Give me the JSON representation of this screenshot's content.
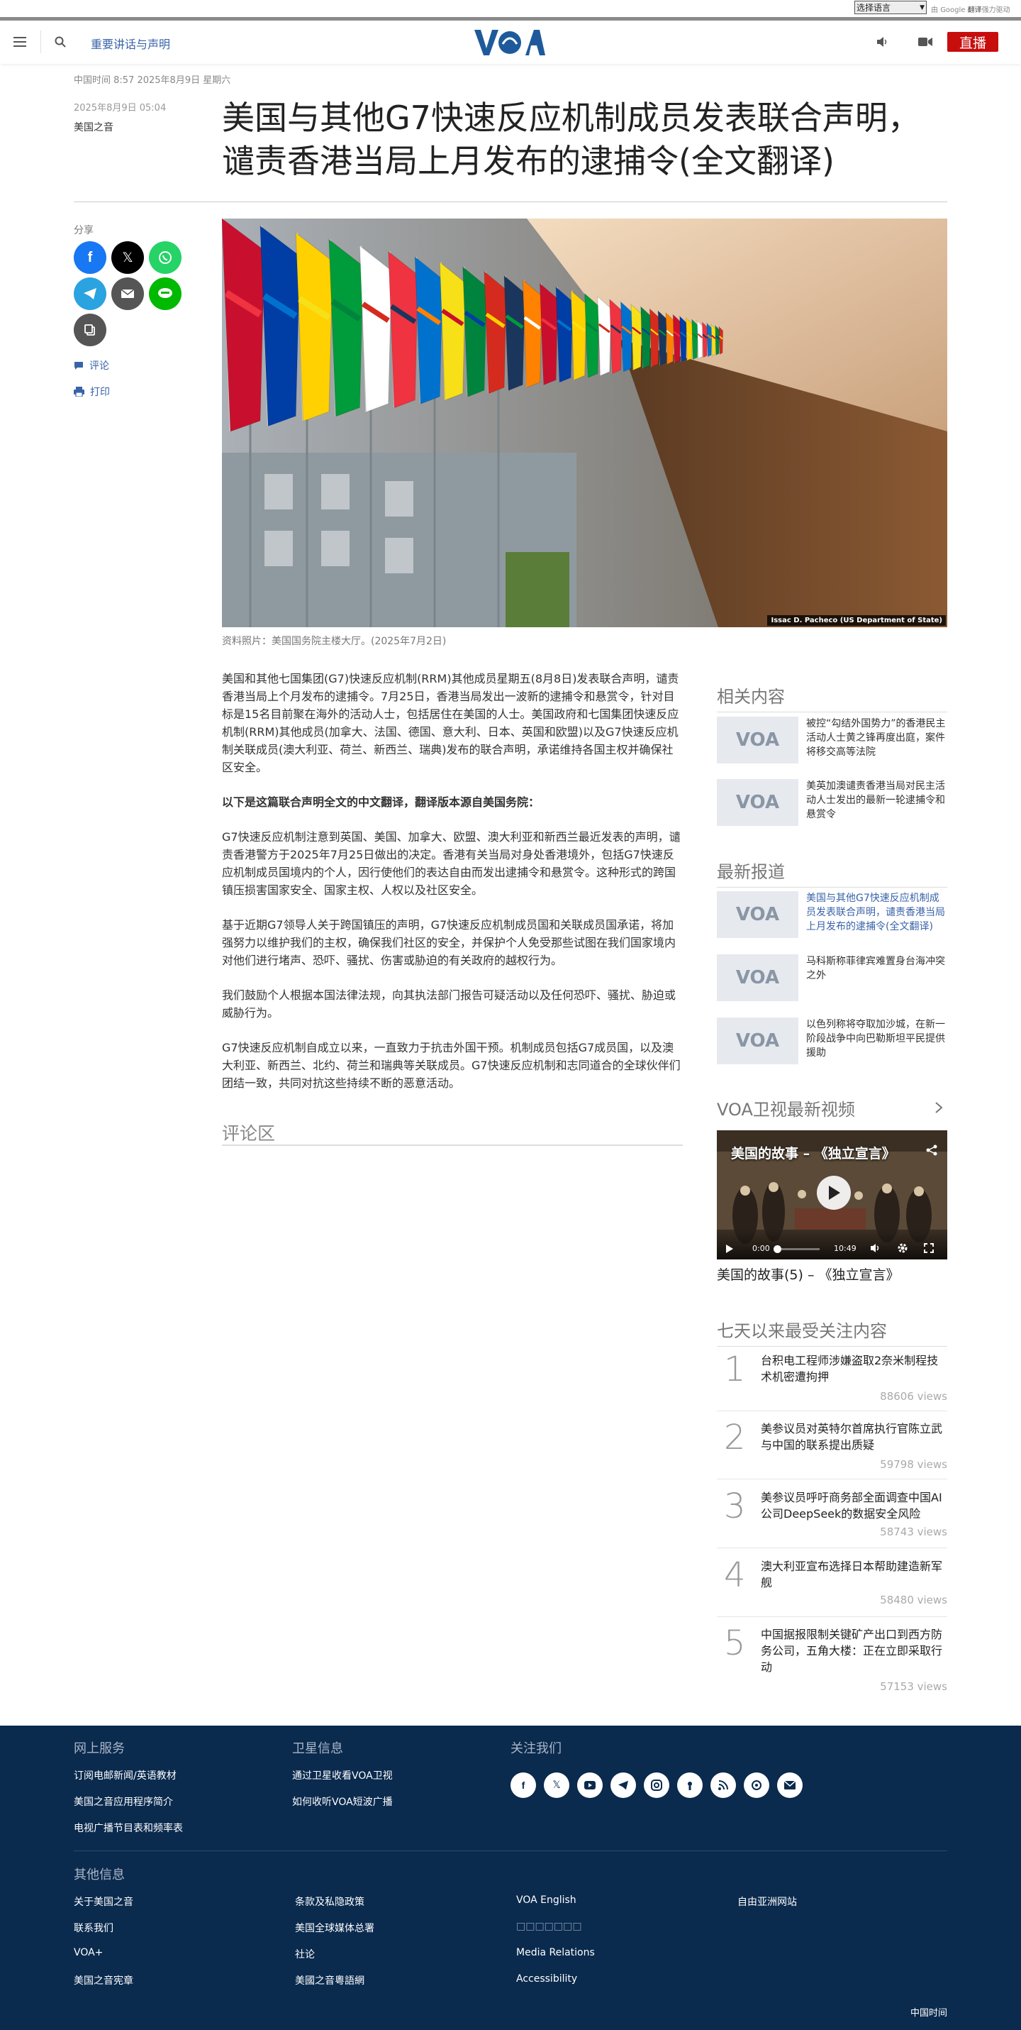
{
  "translate": {
    "select_label": "选择语言",
    "credit_by": "由",
    "credit_google": "Google",
    "credit_translate": "翻译",
    "credit_tail": "强力驱动"
  },
  "header": {
    "section_link": "重要讲话与声明",
    "logo": "VOA",
    "live_label": "直播"
  },
  "dateline": "中国时间 8:57 2025年8月9日 星期六",
  "article": {
    "title": "美国与其他G7快速反应机制成员发表联合声明，谴责香港当局上月发布的逮捕令(全文翻译)",
    "date": "2025年8月9日 05:04",
    "author": "美国之音",
    "image_credit": "Issac D. Pacheco (US Department of State)",
    "caption": "资料照片：美国国务院主楼大厅。(2025年7月2日)",
    "paragraphs": [
      {
        "text": "美国和其他七国集团(G7)快速反应机制(RRM)其他成员星期五(8月8日)发表联合声明，谴责香港当局上个月发布的逮捕令。7月25日，香港当局发出一波新的逮捕令和悬赏令，针对目标是15名目前聚在海外的活动人士，包括居住在美国的人士。美国政府和七国集团快速反应机制(RRM)其他成员(加拿大、法国、德国、意大利、日本、英国和欧盟)以及G7快速反应机制关联成员(澳大利亚、荷兰、新西兰、瑞典)发布的联合声明，承诺维持各国主权并确保社区安全。",
        "bold": false
      },
      {
        "text": "以下是这篇联合声明全文的中文翻译，翻译版本源自美国务院：",
        "bold": true
      },
      {
        "text": "G7快速反应机制注意到英国、美国、加拿大、欧盟、澳大利亚和新西兰最近发表的声明，谴责香港警方于2025年7月25日做出的决定。香港有关当局对身处香港境外，包括G7快速反应机制成员国境内的个人，因行使他们的表达自由而发出逮捕令和悬赏令。这种形式的跨国镇压损害国家安全、国家主权、人权以及社区安全。",
        "bold": false
      },
      {
        "text": "基于近期G7领导人关于跨国镇压的声明，G7快速反应机制成员国和关联成员国承诺，将加强努力以维护我们的主权，确保我们社区的安全，并保护个人免受那些试图在我们国家境内对他们进行堵声、恐吓、骚扰、伤害或胁迫的有关政府的越权行为。",
        "bold": false
      },
      {
        "text": "我们鼓励个人根据本国法律法规，向其执法部门报告可疑活动以及任何恐吓、骚扰、胁迫或威胁行为。",
        "bold": false
      },
      {
        "text": "G7快速反应机制自成立以来，一直致力于抗击外国干预。机制成员包括G7成员国，以及澳大利亚、新西兰、北约、荷兰和瑞典等关联成员。G7快速反应机制和志同道合的全球伙伴们团结一致，共同对抗这些持续不断的恶意活动。",
        "bold": false
      }
    ]
  },
  "sidebar_left": {
    "share_label": "分享",
    "comment_label": "评论",
    "print_label": "打印"
  },
  "comments": {
    "title": "评论区"
  },
  "related": {
    "title": "相关内容",
    "items": [
      {
        "text": "被控“勾结外国势力”的香港民主活动人士黄之锋再度出庭，案件将移交高等法院"
      },
      {
        "text": "美英加澳谴责香港当局对民主活动人士发出的最新一轮逮捕令和悬赏令"
      }
    ]
  },
  "latest": {
    "title": "最新报道",
    "items": [
      {
        "text": "美国与其他G7快速反应机制成员发表联合声明，谴责香港当局上月发布的逮捕令(全文翻译)",
        "active": true
      },
      {
        "text": "马科斯称菲律宾难置身台海冲突之外",
        "active": false
      },
      {
        "text": "以色列称将夺取加沙城，在新一阶段战争中向巴勒斯坦平民提供援助",
        "active": false
      }
    ]
  },
  "video": {
    "section_title": "VOA卫视最新视频",
    "overlay_title": "美国的故事 – 《独立宣言》",
    "time_current": "0:00",
    "time_total": "10:49",
    "progress": 0.0,
    "caption": "美国的故事(5) – 《独立宣言》"
  },
  "popular": {
    "title": "七天以来最受关注内容",
    "items": [
      {
        "rank": "1",
        "text": "台积电工程师涉嫌盗取2奈米制程技术机密遭拘押",
        "views": "88606 views"
      },
      {
        "rank": "2",
        "text": "美参议员对英特尔首席执行官陈立武与中国的联系提出质疑",
        "views": "59798 views"
      },
      {
        "rank": "3",
        "text": "美参议员呼吁商务部全面调查中国AI公司DeepSeek的数据安全风险",
        "views": "58743 views"
      },
      {
        "rank": "4",
        "text": "澳大利亚宣布选择日本帮助建造新军舰",
        "views": "58480 views"
      },
      {
        "rank": "5",
        "text": "中国据报限制关键矿产出口到西方防务公司，五角大楼：正在立即采取行动",
        "views": "57153 views"
      }
    ]
  },
  "footer": {
    "online": {
      "title": "网上服务",
      "links": [
        "订阅电邮新闻/英语教材",
        "美国之音应用程序简介",
        "电视广播节目表和频率表"
      ]
    },
    "satellite": {
      "title": "卫星信息",
      "links": [
        "通过卫星收看VOA卫视",
        "如何收听VOA短波广播"
      ]
    },
    "follow": {
      "title": "关注我们",
      "icons": [
        "facebook-icon",
        "x-icon",
        "youtube-icon",
        "telegram-icon",
        "instagram-icon",
        "podcast-icon",
        "rss-icon",
        "podcast2-icon",
        "email-icon"
      ]
    },
    "other": {
      "title": "其他信息",
      "col1": [
        "关于美国之音",
        "联系我们",
        "VOA+",
        "美国之音宪章"
      ],
      "col2": [
        "条款及私隐政策",
        "美国全球媒体总署",
        "社论",
        "美國之音粵語網"
      ],
      "col3": [
        "VOA English",
        "□□□□□□□",
        "Media Relations",
        "Accessibility"
      ],
      "col4": [
        "自由亚洲网站"
      ]
    },
    "time_label": "中国时间"
  }
}
